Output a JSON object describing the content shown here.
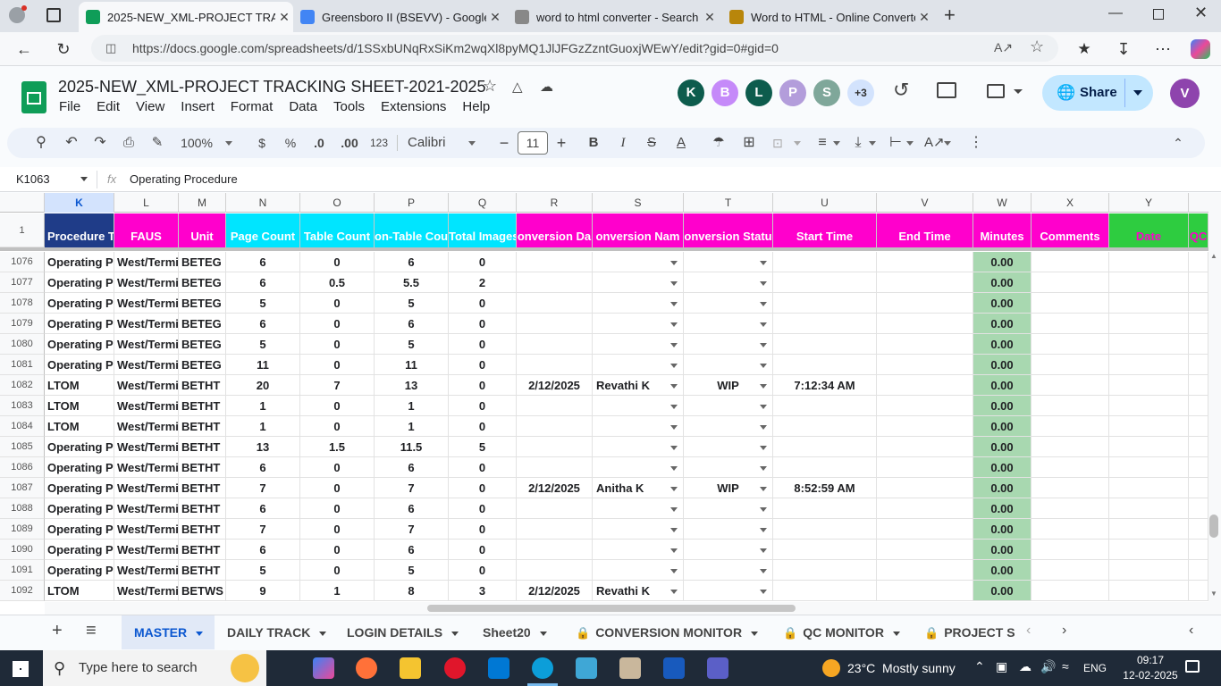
{
  "browser": {
    "tabs": [
      {
        "title": "2025-NEW_XML-PROJECT TRACKI",
        "active": true,
        "color": "#0f9d58"
      },
      {
        "title": "Greensboro II (BSEVV) - Google D",
        "active": false,
        "color": "#4285f4"
      },
      {
        "title": "word to html converter - Search",
        "active": false,
        "color": "#888888"
      },
      {
        "title": "Word to HTML - Online Converte",
        "active": false,
        "color": "#b8860b"
      }
    ],
    "url": "https://docs.google.com/spreadsheets/d/1SSxbUNqRxSiKm2wqXl8pyMQ1JlJFGzZzntGuoxjWEwY/edit?gid=0#gid=0"
  },
  "doc": {
    "title": "2025-NEW_XML-PROJECT TRACKING SHEET-2021-2025",
    "menu": [
      "File",
      "Edit",
      "View",
      "Insert",
      "Format",
      "Data",
      "Tools",
      "Extensions",
      "Help"
    ],
    "avatars": [
      {
        "letter": "K",
        "color": "#0d5c4d"
      },
      {
        "letter": "B",
        "color": "#c58af9"
      },
      {
        "letter": "L",
        "color": "#0d5c4d"
      },
      {
        "letter": "P",
        "color": "#b39ddb"
      },
      {
        "letter": "S",
        "color": "#7fa79a"
      }
    ],
    "more_avatars": "+3",
    "share_label": "Share",
    "user_letter": "V"
  },
  "toolbar": {
    "zoom": "100%",
    "currency": "$",
    "percent": "%",
    "dec_less": ".0",
    "dec_more": ".00",
    "format_num": "123",
    "font": "Calibri",
    "font_size": "11"
  },
  "formula": {
    "cell_ref": "K1063",
    "fx": "fx",
    "value": "Operating Procedure"
  },
  "columns": [
    "K",
    "L",
    "M",
    "N",
    "O",
    "P",
    "Q",
    "R",
    "S",
    "T",
    "U",
    "V",
    "W",
    "X",
    "Y"
  ],
  "header_row_num": "1",
  "headers": [
    "Procedure T",
    "FAUS",
    "Unit",
    "Page Count",
    "Table Count",
    "on-Table Cou",
    "Total Images",
    "onversion Da",
    "onversion Nam",
    "onversion Statu",
    "Start Time",
    "End Time",
    "Minutes",
    "Comments",
    "Date",
    "QC"
  ],
  "header_colors": {
    "blue": "#1f3c88",
    "magenta": "#ff00cc",
    "cyan": "#00e5ff",
    "green": "#2ecc40",
    "minutes_bg": "#a8d8b0"
  },
  "rows": [
    {
      "n": "1076",
      "k": "Operating Pr",
      "l": "West/Termi",
      "m": "BETEG",
      "p": "6",
      "t": "0",
      "nt": "6",
      "img": "0",
      "date": "",
      "name": "",
      "status": "",
      "start": "",
      "min": "0.00"
    },
    {
      "n": "1077",
      "k": "Operating Pr",
      "l": "West/Termi",
      "m": "BETEG",
      "p": "6",
      "t": "0.5",
      "nt": "5.5",
      "img": "2",
      "date": "",
      "name": "",
      "status": "",
      "start": "",
      "min": "0.00"
    },
    {
      "n": "1078",
      "k": "Operating Pr",
      "l": "West/Termi",
      "m": "BETEG",
      "p": "5",
      "t": "0",
      "nt": "5",
      "img": "0",
      "date": "",
      "name": "",
      "status": "",
      "start": "",
      "min": "0.00"
    },
    {
      "n": "1079",
      "k": "Operating Pr",
      "l": "West/Termi",
      "m": "BETEG",
      "p": "6",
      "t": "0",
      "nt": "6",
      "img": "0",
      "date": "",
      "name": "",
      "status": "",
      "start": "",
      "min": "0.00"
    },
    {
      "n": "1080",
      "k": "Operating Pr",
      "l": "West/Termi",
      "m": "BETEG",
      "p": "5",
      "t": "0",
      "nt": "5",
      "img": "0",
      "date": "",
      "name": "",
      "status": "",
      "start": "",
      "min": "0.00"
    },
    {
      "n": "1081",
      "k": "Operating Pr",
      "l": "West/Termi",
      "m": "BETEG",
      "p": "11",
      "t": "0",
      "nt": "11",
      "img": "0",
      "date": "",
      "name": "",
      "status": "",
      "start": "",
      "min": "0.00"
    },
    {
      "n": "1082",
      "k": "LTOM",
      "l": "West/Termi",
      "m": "BETHT",
      "p": "20",
      "t": "7",
      "nt": "13",
      "img": "0",
      "date": "2/12/2025",
      "name": "Revathi K",
      "status": "WIP",
      "start": "7:12:34 AM",
      "min": "0.00"
    },
    {
      "n": "1083",
      "k": "LTOM",
      "l": "West/Termi",
      "m": "BETHT",
      "p": "1",
      "t": "0",
      "nt": "1",
      "img": "0",
      "date": "",
      "name": "",
      "status": "",
      "start": "",
      "min": "0.00"
    },
    {
      "n": "1084",
      "k": "LTOM",
      "l": "West/Termi",
      "m": "BETHT",
      "p": "1",
      "t": "0",
      "nt": "1",
      "img": "0",
      "date": "",
      "name": "",
      "status": "",
      "start": "",
      "min": "0.00"
    },
    {
      "n": "1085",
      "k": "Operating Pr",
      "l": "West/Termi",
      "m": "BETHT",
      "p": "13",
      "t": "1.5",
      "nt": "11.5",
      "img": "5",
      "date": "",
      "name": "",
      "status": "",
      "start": "",
      "min": "0.00"
    },
    {
      "n": "1086",
      "k": "Operating Pr",
      "l": "West/Termi",
      "m": "BETHT",
      "p": "6",
      "t": "0",
      "nt": "6",
      "img": "0",
      "date": "",
      "name": "",
      "status": "",
      "start": "",
      "min": "0.00"
    },
    {
      "n": "1087",
      "k": "Operating Pr",
      "l": "West/Termi",
      "m": "BETHT",
      "p": "7",
      "t": "0",
      "nt": "7",
      "img": "0",
      "date": "2/12/2025",
      "name": "Anitha K",
      "status": "WIP",
      "start": "8:52:59 AM",
      "min": "0.00"
    },
    {
      "n": "1088",
      "k": "Operating Pr",
      "l": "West/Termi",
      "m": "BETHT",
      "p": "6",
      "t": "0",
      "nt": "6",
      "img": "0",
      "date": "",
      "name": "",
      "status": "",
      "start": "",
      "min": "0.00"
    },
    {
      "n": "1089",
      "k": "Operating Pr",
      "l": "West/Termi",
      "m": "BETHT",
      "p": "7",
      "t": "0",
      "nt": "7",
      "img": "0",
      "date": "",
      "name": "",
      "status": "",
      "start": "",
      "min": "0.00"
    },
    {
      "n": "1090",
      "k": "Operating Pr",
      "l": "West/Termi",
      "m": "BETHT",
      "p": "6",
      "t": "0",
      "nt": "6",
      "img": "0",
      "date": "",
      "name": "",
      "status": "",
      "start": "",
      "min": "0.00"
    },
    {
      "n": "1091",
      "k": "Operating Pr",
      "l": "West/Termi",
      "m": "BETHT",
      "p": "5",
      "t": "0",
      "nt": "5",
      "img": "0",
      "date": "",
      "name": "",
      "status": "",
      "start": "",
      "min": "0.00"
    },
    {
      "n": "1092",
      "k": "LTOM",
      "l": "West/Termi",
      "m": "BETWS",
      "p": "9",
      "t": "1",
      "nt": "8",
      "img": "3",
      "date": "2/12/2025",
      "name": "Revathi K",
      "status": "",
      "start": "",
      "min": "0.00"
    }
  ],
  "sheets": [
    {
      "label": "MASTER",
      "active": true,
      "locked": false
    },
    {
      "label": "DAILY TRACK",
      "active": false,
      "locked": false
    },
    {
      "label": "LOGIN DETAILS",
      "active": false,
      "locked": false
    },
    {
      "label": "Sheet20",
      "active": false,
      "locked": false
    },
    {
      "label": "CONVERSION MONITOR",
      "active": false,
      "locked": true
    },
    {
      "label": "QC MONITOR",
      "active": false,
      "locked": true
    },
    {
      "label": "PROJECT S",
      "active": false,
      "locked": true
    }
  ],
  "taskbar": {
    "search_placeholder": "Type here to search",
    "weather": "23°C  Mostly sunny",
    "lang": "ENG",
    "time": "09:17",
    "date": "12-02-2025"
  }
}
